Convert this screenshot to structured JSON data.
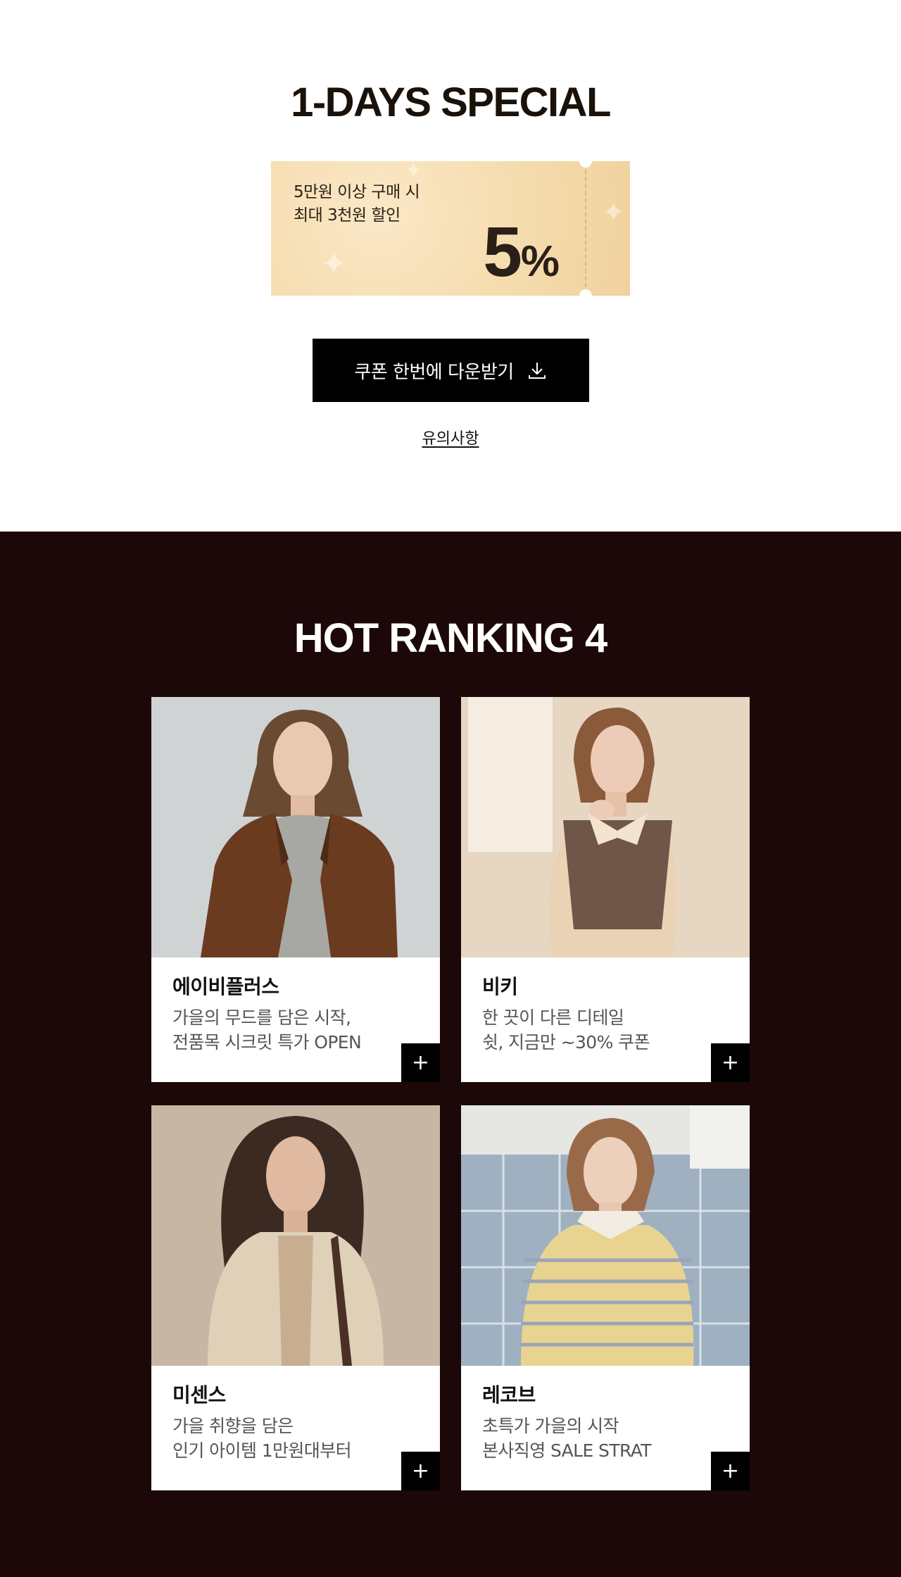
{
  "special": {
    "title": "1-DAYS SPECIAL",
    "coupon": {
      "condition_line1": "5만원 이상 구매 시",
      "condition_line2": "최대 3천원 할인",
      "rate": "5",
      "rate_unit": "%"
    },
    "download_button_label": "쿠폰 한번에 다운받기",
    "notice_link": "유의사항"
  },
  "ranking": {
    "title": "HOT RANKING 4",
    "items": [
      {
        "brand": "에이비플러스",
        "desc_line1": "가을의 무드를 담은 시작,",
        "desc_line2": "전품목 시크릿 특가 OPEN",
        "plus": "+"
      },
      {
        "brand": "비키",
        "desc_line1": "한 끗이 다른 디테일",
        "desc_line2": "쉿, 지금만 ~30% 쿠폰",
        "plus": "+"
      },
      {
        "brand": "미센스",
        "desc_line1": "가을 취향을 담은",
        "desc_line2": "인기 아이템 1만원대부터",
        "plus": "+"
      },
      {
        "brand": "레코브",
        "desc_line1": "초특가 가을의 시작",
        "desc_line2": "본사직영 SALE STRAT",
        "plus": "+"
      }
    ]
  },
  "colors": {
    "ranking_background": "#1c0808",
    "coupon_background": "#f5dcae",
    "button_background": "#000000"
  }
}
